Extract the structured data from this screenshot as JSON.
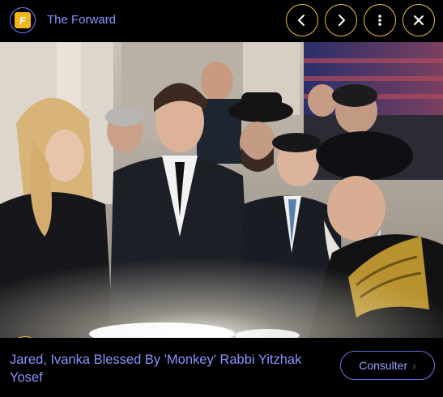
{
  "header": {
    "source_name": "The Forward",
    "logo_letter": "F",
    "controls": {
      "previous": "chevron-left-icon",
      "next": "chevron-right-icon",
      "more": "more-vertical-icon",
      "close": "close-icon"
    }
  },
  "image": {
    "lens_icon": "lens-search-icon"
  },
  "footer": {
    "caption": "Jared, Ivanka Blessed By 'Monkey' Rabbi Yitzhak Yosef",
    "visit_label": "Consulter",
    "visit_chevron": "›"
  },
  "colors": {
    "accent_text": "#8a93ff",
    "control_ring": "#e8c43a",
    "logo_bg": "#f2b51c"
  }
}
